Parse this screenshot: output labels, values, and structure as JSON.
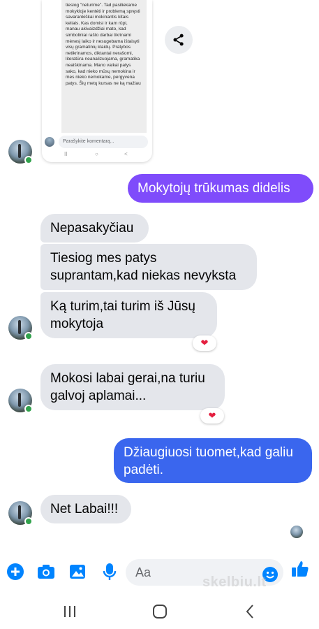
{
  "shared_post": {
    "text": "tiesiog \"neturime\". Tad pasiliekame mokykloje kentėti ir problemą spręsti savarankiškai mokinantis kitais keliais. Kas domisi ir kam rūpi, manau akivaizdžiai mato, kad simboliniai rašto darbai tikrinami mėnesį laiko ir nesugebama ištaisyti visų gramatinių klaidų. Pratybos netikrinamos, diktantai nerašomi, literatūra neanalizuojama, gramatika neaiškinama. Mano vaikai patys sako, kad nieko mūsų nemokina ir mes nieko nemokame, pergyvena patys. Šių metų kursas ne ką mažiau",
    "comment_placeholder": "Parašykite komentarą...",
    "nav": [
      "II",
      "○",
      "<"
    ]
  },
  "messages": [
    {
      "text": "Mokytojų trūkumas didelis"
    },
    {
      "text": "Nepasakyčiau"
    },
    {
      "text": "Tiesiog mes patys suprantam,kad niekas nevyksta"
    },
    {
      "text": "Ką turim,tai turim iš Jūsų mokytoja"
    },
    {
      "text": "Mokosi labai gerai,na turiu galvoj aplamai..."
    },
    {
      "text": "Džiaugiuosi tuomet,kad galiu padėti."
    },
    {
      "text": "Net Labai!!!"
    }
  ],
  "reactions": {
    "icon": "heart-icon",
    "symbol": "❤"
  },
  "composer": {
    "placeholder": "Aa"
  },
  "watermark": "skelbiu.lt",
  "colors": {
    "outgoing_top": "#7d4dfb",
    "outgoing_bottom": "#3a66ee",
    "incoming": "#e4e6eb",
    "accent": "#0084ff",
    "online": "#31a24c"
  }
}
